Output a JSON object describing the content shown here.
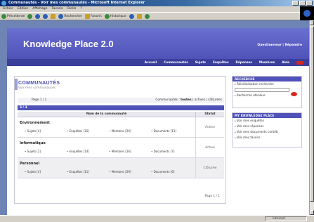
{
  "window": {
    "title": "Communautés - Voir mes communautés - Microsoft Internet Explorer"
  },
  "menubar": [
    "Fichier",
    "Edition",
    "Affichage",
    "Favoris",
    "Outils",
    "?"
  ],
  "toolbar": {
    "back_label": "Précédente",
    "search_label": "Rechercher",
    "favorites_label": "Favoris",
    "history_label": "Historique",
    "address_label": "Adresse"
  },
  "site": {
    "title": "Knowledge Place 2.0",
    "user": "Questionneur | Répondre",
    "nav": [
      "Accueil",
      "Communautés",
      "Sujets",
      "Enquêtes",
      "Réponses",
      "Membres",
      "Aide"
    ]
  },
  "page": {
    "title": "COMMUNAUTÉS",
    "subtitle": "Voir mes communautés",
    "pager": "Page 1 / 1",
    "filter_label": "Communautés :",
    "filter_active": "toutes",
    "filter_rest": "| actives | clôturées",
    "count": "3 / 3",
    "col_name": "Nom de la communauté",
    "col_status": "Statut",
    "pager_bottom": "Page 1 / 1"
  },
  "communities": [
    {
      "name": "Environnement",
      "subjects": "Sujets [4]",
      "surveys": "Enquêtes [15]",
      "members": "Membres [26]",
      "documents": "Documents [11]",
      "status": "Active"
    },
    {
      "name": "Informatique",
      "subjects": "Sujets [2]",
      "surveys": "Enquêtes [14]",
      "members": "Membres [16]",
      "documents": "Documents [7]",
      "status": "Active"
    },
    {
      "name": "Personnel",
      "subjects": "Sujets [4]",
      "surveys": "Enquêtes [11]",
      "members": "Membres [29]",
      "documents": "Documents [6]",
      "status": "Clôturée"
    }
  ],
  "sidebar": {
    "search_head": "RECHERCHE",
    "search_items": [
      "Réinitialisation recherche",
      "Recherche étendue"
    ],
    "kp_head": "MY KNOWLEDGE PLACE",
    "kp_items": [
      "Voir mes enquêtes",
      "Voir mes réponses",
      "Voir mes documents contrib",
      "Voir mes favoris"
    ]
  },
  "status": {
    "zone": "Internet"
  }
}
